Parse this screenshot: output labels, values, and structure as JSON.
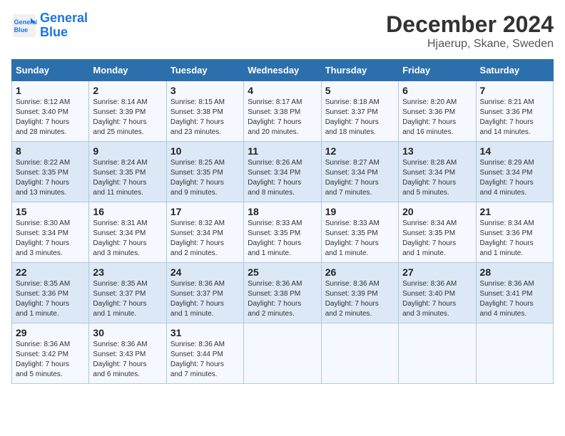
{
  "logo": {
    "line1": "General",
    "line2": "Blue"
  },
  "title": "December 2024",
  "subtitle": "Hjaerup, Skane, Sweden",
  "weekdays": [
    "Sunday",
    "Monday",
    "Tuesday",
    "Wednesday",
    "Thursday",
    "Friday",
    "Saturday"
  ],
  "weeks": [
    [
      {
        "day": "1",
        "info": "Sunrise: 8:12 AM\nSunset: 3:40 PM\nDaylight: 7 hours\nand 28 minutes."
      },
      {
        "day": "2",
        "info": "Sunrise: 8:14 AM\nSunset: 3:39 PM\nDaylight: 7 hours\nand 25 minutes."
      },
      {
        "day": "3",
        "info": "Sunrise: 8:15 AM\nSunset: 3:38 PM\nDaylight: 7 hours\nand 23 minutes."
      },
      {
        "day": "4",
        "info": "Sunrise: 8:17 AM\nSunset: 3:38 PM\nDaylight: 7 hours\nand 20 minutes."
      },
      {
        "day": "5",
        "info": "Sunrise: 8:18 AM\nSunset: 3:37 PM\nDaylight: 7 hours\nand 18 minutes."
      },
      {
        "day": "6",
        "info": "Sunrise: 8:20 AM\nSunset: 3:36 PM\nDaylight: 7 hours\nand 16 minutes."
      },
      {
        "day": "7",
        "info": "Sunrise: 8:21 AM\nSunset: 3:36 PM\nDaylight: 7 hours\nand 14 minutes."
      }
    ],
    [
      {
        "day": "8",
        "info": "Sunrise: 8:22 AM\nSunset: 3:35 PM\nDaylight: 7 hours\nand 13 minutes."
      },
      {
        "day": "9",
        "info": "Sunrise: 8:24 AM\nSunset: 3:35 PM\nDaylight: 7 hours\nand 11 minutes."
      },
      {
        "day": "10",
        "info": "Sunrise: 8:25 AM\nSunset: 3:35 PM\nDaylight: 7 hours\nand 9 minutes."
      },
      {
        "day": "11",
        "info": "Sunrise: 8:26 AM\nSunset: 3:34 PM\nDaylight: 7 hours\nand 8 minutes."
      },
      {
        "day": "12",
        "info": "Sunrise: 8:27 AM\nSunset: 3:34 PM\nDaylight: 7 hours\nand 7 minutes."
      },
      {
        "day": "13",
        "info": "Sunrise: 8:28 AM\nSunset: 3:34 PM\nDaylight: 7 hours\nand 5 minutes."
      },
      {
        "day": "14",
        "info": "Sunrise: 8:29 AM\nSunset: 3:34 PM\nDaylight: 7 hours\nand 4 minutes."
      }
    ],
    [
      {
        "day": "15",
        "info": "Sunrise: 8:30 AM\nSunset: 3:34 PM\nDaylight: 7 hours\nand 3 minutes."
      },
      {
        "day": "16",
        "info": "Sunrise: 8:31 AM\nSunset: 3:34 PM\nDaylight: 7 hours\nand 3 minutes."
      },
      {
        "day": "17",
        "info": "Sunrise: 8:32 AM\nSunset: 3:34 PM\nDaylight: 7 hours\nand 2 minutes."
      },
      {
        "day": "18",
        "info": "Sunrise: 8:33 AM\nSunset: 3:35 PM\nDaylight: 7 hours\nand 1 minute."
      },
      {
        "day": "19",
        "info": "Sunrise: 8:33 AM\nSunset: 3:35 PM\nDaylight: 7 hours\nand 1 minute."
      },
      {
        "day": "20",
        "info": "Sunrise: 8:34 AM\nSunset: 3:35 PM\nDaylight: 7 hours\nand 1 minute."
      },
      {
        "day": "21",
        "info": "Sunrise: 8:34 AM\nSunset: 3:36 PM\nDaylight: 7 hours\nand 1 minute."
      }
    ],
    [
      {
        "day": "22",
        "info": "Sunrise: 8:35 AM\nSunset: 3:36 PM\nDaylight: 7 hours\nand 1 minute."
      },
      {
        "day": "23",
        "info": "Sunrise: 8:35 AM\nSunset: 3:37 PM\nDaylight: 7 hours\nand 1 minute."
      },
      {
        "day": "24",
        "info": "Sunrise: 8:36 AM\nSunset: 3:37 PM\nDaylight: 7 hours\nand 1 minute."
      },
      {
        "day": "25",
        "info": "Sunrise: 8:36 AM\nSunset: 3:38 PM\nDaylight: 7 hours\nand 2 minutes."
      },
      {
        "day": "26",
        "info": "Sunrise: 8:36 AM\nSunset: 3:39 PM\nDaylight: 7 hours\nand 2 minutes."
      },
      {
        "day": "27",
        "info": "Sunrise: 8:36 AM\nSunset: 3:40 PM\nDaylight: 7 hours\nand 3 minutes."
      },
      {
        "day": "28",
        "info": "Sunrise: 8:36 AM\nSunset: 3:41 PM\nDaylight: 7 hours\nand 4 minutes."
      }
    ],
    [
      {
        "day": "29",
        "info": "Sunrise: 8:36 AM\nSunset: 3:42 PM\nDaylight: 7 hours\nand 5 minutes."
      },
      {
        "day": "30",
        "info": "Sunrise: 8:36 AM\nSunset: 3:43 PM\nDaylight: 7 hours\nand 6 minutes."
      },
      {
        "day": "31",
        "info": "Sunrise: 8:36 AM\nSunset: 3:44 PM\nDaylight: 7 hours\nand 7 minutes."
      },
      null,
      null,
      null,
      null
    ]
  ]
}
